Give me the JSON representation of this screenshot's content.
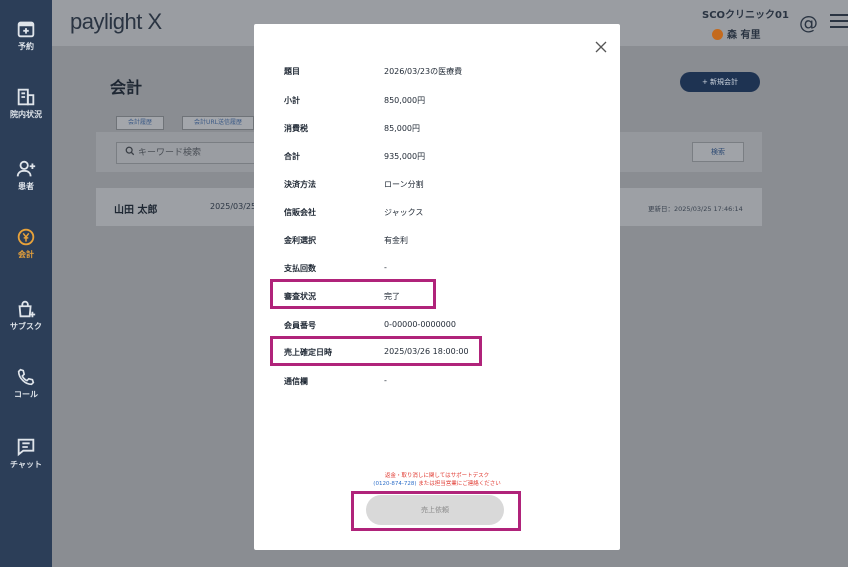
{
  "sidebar": {
    "items": [
      {
        "label": "予約",
        "icon": "calendar-plus-icon"
      },
      {
        "label": "院内状況",
        "icon": "building-icon"
      },
      {
        "label": "患者",
        "icon": "person-add-icon"
      },
      {
        "label": "会計",
        "icon": "yen-icon",
        "active": true
      },
      {
        "label": "サブスク",
        "icon": "bag-plus-icon"
      },
      {
        "label": "コール",
        "icon": "phone-icon"
      },
      {
        "label": "チャット",
        "icon": "chat-icon"
      }
    ]
  },
  "header": {
    "logo": "paylight X",
    "clinic_name": "SCOクリニック01",
    "user_name": "森 有里",
    "mention_icon": "at-icon",
    "menu_icon": "hamburger-menu-icon"
  },
  "main": {
    "title": "会計",
    "new_button": "+ 新規会計",
    "tabs": [
      "会計履歴",
      "会計URL送信履歴"
    ],
    "search_placeholder": "キーワード検索",
    "search_button": "検索",
    "record": {
      "name": "山田 太郎",
      "date": "2025/03/25",
      "updated": "更新日：2025/03/25 17:46:14"
    }
  },
  "modal": {
    "rows": [
      {
        "label": "題目",
        "value": "2026/03/23の医療費"
      },
      {
        "label": "小計",
        "value": "850,000円"
      },
      {
        "label": "消費税",
        "value": "85,000円"
      },
      {
        "label": "合計",
        "value": "935,000円"
      },
      {
        "label": "決済方法",
        "value": "ローン分割"
      },
      {
        "label": "信販会社",
        "value": "ジャックス"
      },
      {
        "label": "金利選択",
        "value": "有金利"
      },
      {
        "label": "支払回数",
        "value": "-"
      },
      {
        "label": "審査状況",
        "value": "完了"
      },
      {
        "label": "会員番号",
        "value": "0-00000-0000000"
      },
      {
        "label": "売上確定日時",
        "value": "2025/03/26 18:00:00"
      },
      {
        "label": "通信欄",
        "value": "-"
      }
    ],
    "notice_line1": "返金・取り消しに関してはサポートデスク",
    "notice_tel": "(0120-874-728)",
    "notice_line2": " または担当営業にご連絡ください",
    "sales_request_button": "売上依頼"
  },
  "colors": {
    "highlight": "#b0237a",
    "sidebar_bg": "#2c3e58",
    "active_nav": "#e8a23a",
    "notice_red": "#e0372e"
  }
}
